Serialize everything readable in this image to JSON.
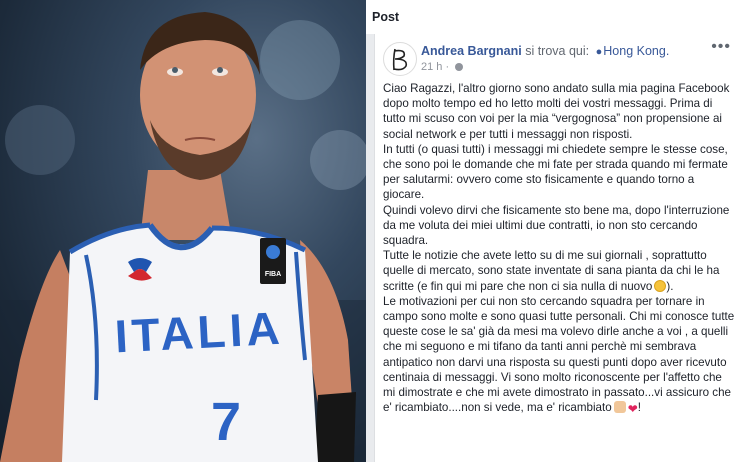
{
  "panel": {
    "title": "Post"
  },
  "post": {
    "author": "Andrea Bargnani",
    "location_prefix": "si trova qui:",
    "location": "Hong Kong.",
    "time": "21 h",
    "separator": "·",
    "more_icon": "more-dots-icon",
    "paragraphs": {
      "p1": "Ciao Ragazzi, l'altro giorno sono andato sulla mia pagina Facebook dopo molto tempo ed ho letto molti dei vostri messaggi. Prima di tutto mi scuso con voi per la mia “vergognosa” non propensione ai social network e per tutti i messaggi non risposti.",
      "p2": "In tutti (o quasi tutti) i messaggi mi chiedete sempre le stesse cose, che sono poi le domande che mi fate per strada quando mi fermate per salutarmi: ovvero come sto fisicamente e quando torno a giocare.",
      "p3": "Quindi volevo dirvi che fisicamente sto bene ma, dopo l'interruzione da me voluta dei miei ultimi due contratti, io non sto cercando squadra.",
      "p4": "Tutte le notizie che avete letto su di me sui giornali , soprattutto quelle di mercato, sono state inventate di sana pianta da chi le ha scritte (e fin qui mi pare che non ci sia nulla di nuovo",
      "p4_end": ").",
      "p5": "Le motivazioni per cui non sto cercando squadra per tornare in campo sono molte e sono quasi tutte personali. Chi mi conosce tutte queste cose le sa' già da mesi ma volevo dirle anche a voi , a quelli che mi seguono e mi tifano da tanti anni perchè mi sembrava antipatico non darvi una risposta su questi punti dopo aver ricevuto centinaia di messaggi. Vi sono molto riconoscente per l'affetto che mi dimostrate e che mi avete dimostrato in passato...vi assicuro che e' ricambiato....non si vede, ma e' ricambiato",
      "p5_end": "!"
    },
    "emojis": [
      "smile-emoji",
      "thumbs-up-emoji",
      "heart-emoji"
    ]
  },
  "photo": {
    "jersey_text": "ITALIA",
    "jersey_number": "7",
    "badge_text": "FIBA"
  }
}
